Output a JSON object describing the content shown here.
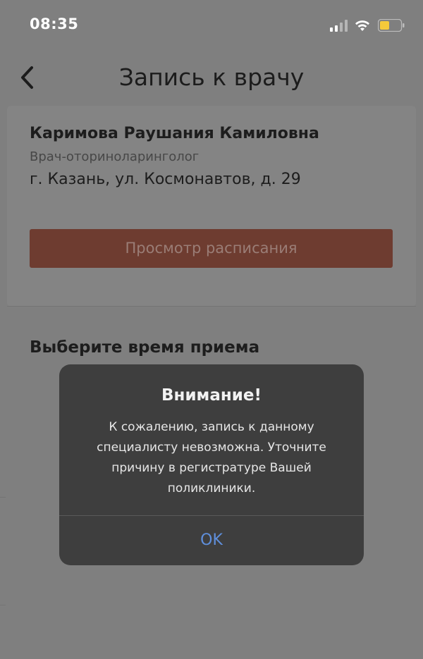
{
  "status_bar": {
    "time": "08:35",
    "icons": [
      "signal-icon",
      "wifi-icon",
      "battery-icon"
    ],
    "battery_color": "#f5c93a"
  },
  "nav": {
    "back_icon": "chevron-left-icon",
    "title": "Запись к врачу"
  },
  "doctor": {
    "name": "Каримова Раушания Камиловна",
    "specialty": "Врач-оториноларинголог",
    "address": "г. Казань, ул. Космонавтов, д. 29",
    "schedule_button_label": "Просмотр расписания",
    "accent_color": "#6e3c30"
  },
  "time_section": {
    "title": "Выберите время приема"
  },
  "alert": {
    "title": "Внимание!",
    "message": "К сожалению, запись к данному специалисту невозможна. Уточните причину в регистратуре Вашей поликлиники.",
    "ok_label": "OK",
    "ok_color": "#5f8fdc"
  }
}
